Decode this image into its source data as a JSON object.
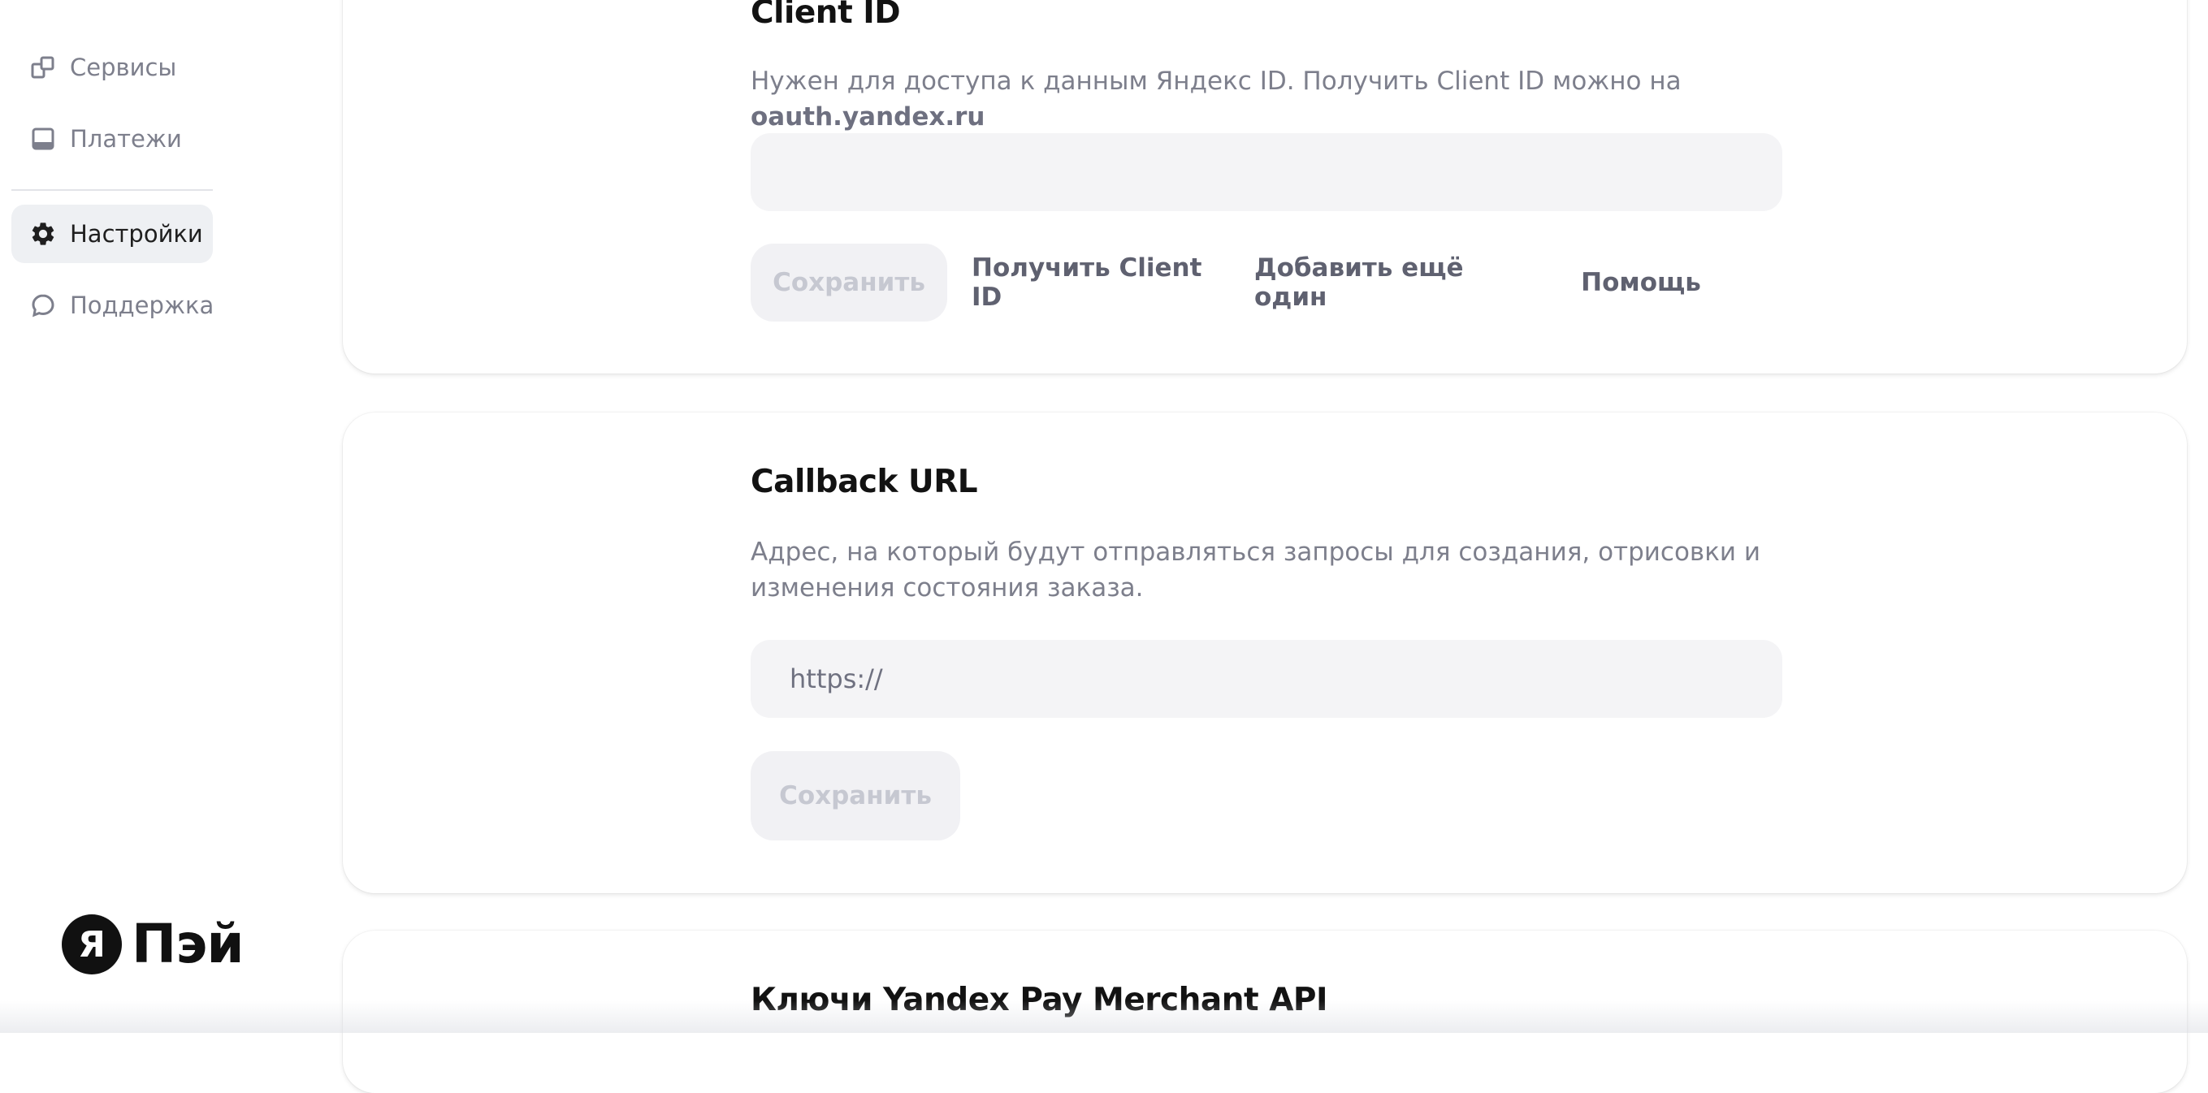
{
  "sidebar": {
    "items": [
      {
        "label": "Сервисы",
        "icon": "services-icon",
        "active": false
      },
      {
        "label": "Платежи",
        "icon": "payments-icon",
        "active": false
      },
      {
        "label": "Настройки",
        "icon": "gear-icon",
        "active": true
      },
      {
        "label": "Поддержка",
        "icon": "chat-bubble-icon",
        "active": false
      }
    ],
    "brand": {
      "mark": "Я",
      "name": "Пэй"
    }
  },
  "cards": {
    "client_id": {
      "title": "Client ID",
      "description_prefix": "Нужен для доступа к данным Яндекс ID. Получить Client ID можно на ",
      "description_link": "oauth.yandex.ru",
      "input_value": "",
      "buttons": {
        "save": "Сохранить",
        "get_client_id": "Получить Client ID",
        "add_another": "Добавить ещё один",
        "help": "Помощь"
      }
    },
    "callback": {
      "title": "Callback URL",
      "description_line1": "Адрес, на который будут отправляться запросы для создания, отрисовки и",
      "description_line2": "изменения состояния заказа.",
      "input_placeholder": "https://",
      "buttons": {
        "save": "Сохранить"
      }
    },
    "merchant_api": {
      "title": "Ключи Yandex Pay Merchant API"
    }
  },
  "colors": {
    "active_nav_bg": "#eef0f3",
    "muted_text": "#7d7f8c",
    "input_bg": "#f4f4f6",
    "disabled_button_bg": "#f1f1f4",
    "disabled_button_text": "#c6c8d1"
  }
}
